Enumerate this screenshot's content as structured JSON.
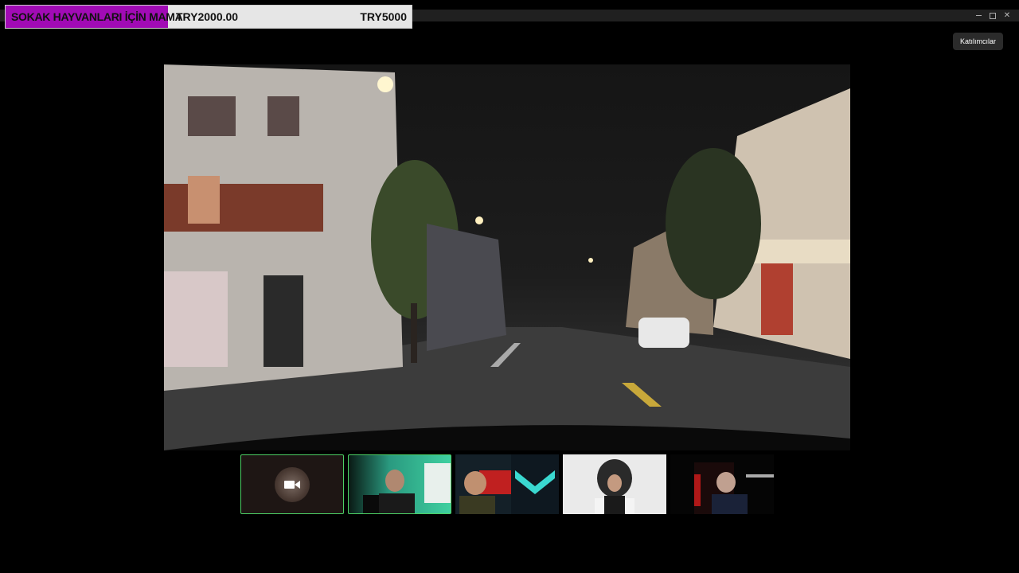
{
  "donation": {
    "title": "SOKAK HAYVANLARI İÇİN MAMA",
    "current": "TRY2000.00",
    "goal": "TRY5000",
    "progress_fraction": 0.4,
    "fill_color": "#a10bb5"
  },
  "tooltip": {
    "label": "Katılımcılar"
  },
  "window_controls": [
    "minimize-icon",
    "maximize-icon",
    "close-icon"
  ],
  "participants": [
    {
      "id": "p1",
      "icon": "camera-icon",
      "video_off": true
    },
    {
      "id": "p2",
      "bg": "#2a8c7a"
    },
    {
      "id": "p3",
      "bg": "#1a2a35"
    },
    {
      "id": "p4",
      "bg": "#e8e8e8"
    },
    {
      "id": "p5",
      "bg": "#050505"
    }
  ],
  "colors": {
    "active_border": "#4ccf64",
    "background": "#000000"
  }
}
